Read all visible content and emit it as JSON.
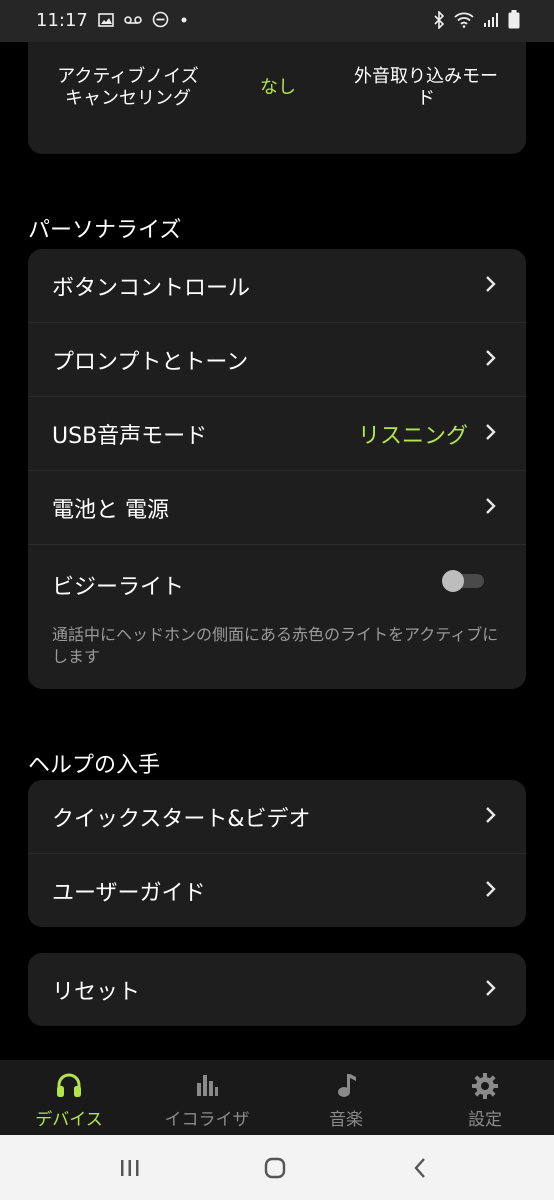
{
  "status_bar": {
    "time": "11:17",
    "left_icons": [
      "image-icon",
      "voicemail-icon",
      "do-not-disturb-icon",
      "dot-icon"
    ],
    "right_icons": [
      "bluetooth-icon",
      "wifi-icon",
      "signal-icon",
      "battery-icon"
    ]
  },
  "anc": {
    "left_label": "アクティブノイズキャンセリング",
    "left_line1": "アクティブノイズ",
    "left_line2": "キャンセリング",
    "middle_label": "なし",
    "right_line1": "外音取り込みモー",
    "right_line2": "ド"
  },
  "personalize": {
    "title": "パーソナライズ",
    "items": [
      {
        "label": "ボタンコントロール",
        "value": ""
      },
      {
        "label": "プロンプトとトーン",
        "value": ""
      },
      {
        "label": "USB音声モード",
        "value": "リスニング"
      },
      {
        "label": "電池と 電源",
        "value": ""
      }
    ],
    "busy_light": {
      "label": "ビジーライト",
      "description": "通話中にヘッドホンの側面にある赤色のライトをアクティブにします",
      "enabled": false
    }
  },
  "help": {
    "title": "ヘルプの入手",
    "items": [
      {
        "label": "クイックスタート&ビデオ"
      },
      {
        "label": "ユーザーガイド"
      }
    ]
  },
  "reset": {
    "label": "リセット"
  },
  "tabs": [
    {
      "label": "デバイス",
      "icon": "headphones-icon",
      "active": true
    },
    {
      "label": "イコライザ",
      "icon": "equalizer-icon",
      "active": false
    },
    {
      "label": "音楽",
      "icon": "music-note-icon",
      "active": false
    },
    {
      "label": "設定",
      "icon": "gear-icon",
      "active": false
    }
  ],
  "colors": {
    "accent": "#b4e34a",
    "card": "#1e1e1e",
    "background": "#000000"
  }
}
